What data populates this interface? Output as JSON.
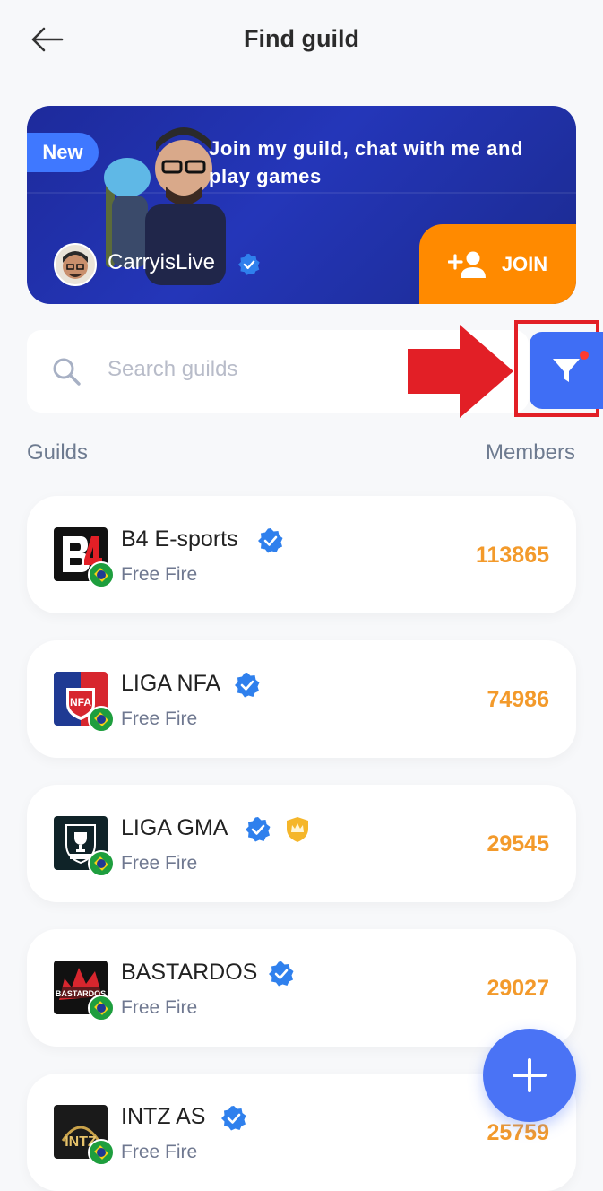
{
  "header": {
    "title": "Find guild",
    "back_icon": "back-arrow-icon"
  },
  "banner": {
    "badge": "New",
    "message": "Join my guild, chat with me and play games",
    "creator": "CarryisLive",
    "join_label": "JOIN",
    "colors": {
      "background": "#2436b9",
      "badge": "#3f78ff",
      "join": "#ff8a00"
    }
  },
  "search": {
    "placeholder": "Search guilds",
    "icon": "search-icon",
    "filter_icon": "filter-icon"
  },
  "columns": {
    "left": "Guilds",
    "right": "Members"
  },
  "guilds": [
    {
      "name": "B4 E-sports",
      "game": "Free Fire",
      "members": "113865",
      "verified": true,
      "crown": false
    },
    {
      "name": "LIGA NFA",
      "game": "Free Fire",
      "members": "74986",
      "verified": true,
      "crown": false
    },
    {
      "name": "LIGA GMA",
      "game": "Free Fire",
      "members": "29545",
      "verified": true,
      "crown": true
    },
    {
      "name": "BASTARDOS",
      "game": "Free Fire",
      "members": "29027",
      "verified": true,
      "crown": false
    },
    {
      "name": "INTZ AS",
      "game": "Free Fire",
      "members": "25759",
      "verified": true,
      "crown": false
    }
  ],
  "colors": {
    "accent": "#3f6ef5",
    "member_count": "#f39a2b",
    "highlight": "#e21f26"
  },
  "fab_icon": "plus-icon"
}
